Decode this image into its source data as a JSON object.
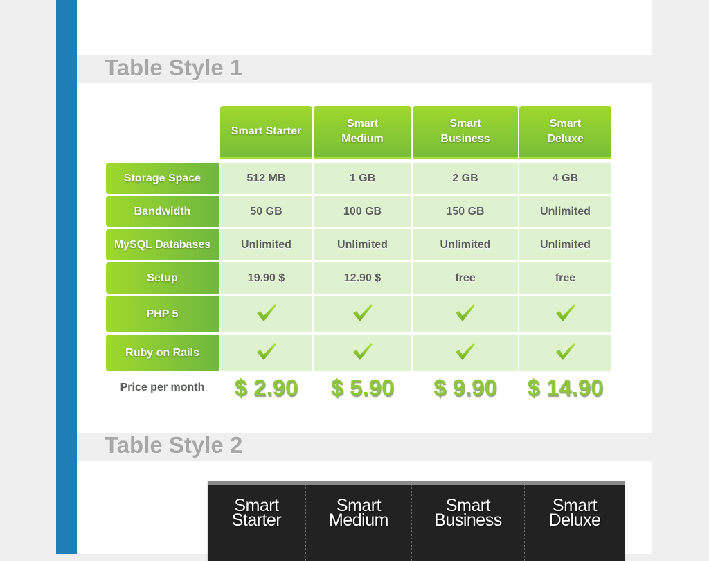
{
  "sections": [
    {
      "title": "Table Style 1"
    },
    {
      "title": "Table Style 2"
    }
  ],
  "table1": {
    "plans": [
      {
        "name_line1": "Smart Starter",
        "name_line2": "",
        "price": "$ 2.90"
      },
      {
        "name_line1": "Smart",
        "name_line2": "Medium",
        "price": "$ 5.90"
      },
      {
        "name_line1": "Smart",
        "name_line2": "Business",
        "price": "$ 9.90"
      },
      {
        "name_line1": "Smart",
        "name_line2": "Deluxe",
        "price": "$ 14.90"
      }
    ],
    "rows": [
      {
        "label": "Storage Space",
        "values": [
          "512 MB",
          "1 GB",
          "2 GB",
          "4 GB"
        ]
      },
      {
        "label": "Bandwidth",
        "values": [
          "50 GB",
          "100 GB",
          "150 GB",
          "Unlimited"
        ]
      },
      {
        "label": "MySQL Databases",
        "values": [
          "Unlimited",
          "Unlimited",
          "Unlimited",
          "Unlimited"
        ]
      },
      {
        "label": "Setup",
        "values": [
          "19.90 $",
          "12.90 $",
          "free",
          "free"
        ]
      },
      {
        "label": "PHP 5",
        "values": [
          "check-icon",
          "check-icon",
          "check-icon",
          "check-icon"
        ]
      },
      {
        "label": "Ruby on Rails",
        "values": [
          "check-icon",
          "check-icon",
          "check-icon",
          "check-icon"
        ]
      }
    ],
    "price_label": "Price per month"
  },
  "table2": {
    "plans": [
      {
        "line1": "Smart",
        "line2": "Starter"
      },
      {
        "line1": "Smart",
        "line2": "Medium"
      },
      {
        "line1": "Smart",
        "line2": "Business"
      },
      {
        "line1": "Smart",
        "line2": "Deluxe"
      }
    ]
  },
  "colors": {
    "sidebar": "#1e7fb4",
    "header_green_top": "#9fd92c",
    "header_green_bottom": "#78bd3a",
    "cell_bg": "#dff2cf",
    "price_green": "#8cc83a",
    "dark_table": "#222222"
  }
}
